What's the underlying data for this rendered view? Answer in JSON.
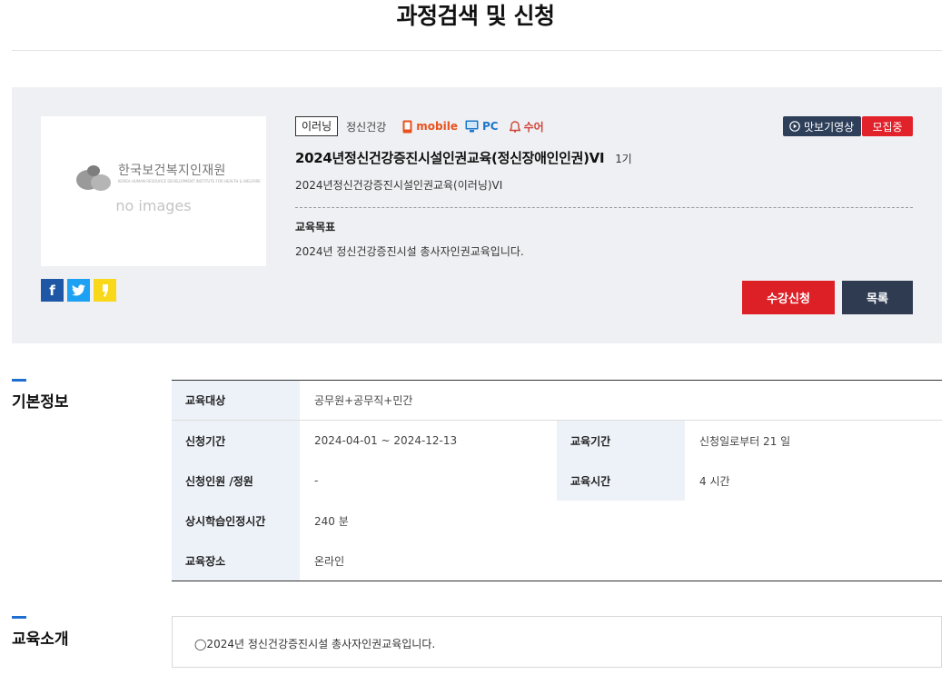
{
  "page": {
    "title": "과정검색 및 신청"
  },
  "thumbnail": {
    "brand": "한국보건복지인재원",
    "brand_sub": "KOREA HUMAN RESOURCE DEVELOPMENT INSTITUTE FOR HEALTH & WELFARE",
    "placeholder": "no images"
  },
  "share": {
    "facebook": "f",
    "twitter": "t",
    "kakaostory": "k"
  },
  "course": {
    "type_tag": "이러닝",
    "category": "정신건강",
    "device_mobile": "mobile",
    "device_pc": "PC",
    "sign_language": "수어",
    "preview_label": "맛보기영상",
    "status_badge": "모집중",
    "title": "2024년정신건강증진시설인권교육(정신장애인인권)VI",
    "round": "1기",
    "subtitle": "2024년정신건강증진시설인권교육(이러닝)VI",
    "goal_label": "교육목표",
    "goal_text": "2024년 정신건강증진시설 총사자인권교육입니다.",
    "apply_label": "수강신청",
    "list_label": "목록"
  },
  "basic_info": {
    "section_title": "기본정보",
    "target_label": "교육대상",
    "target_value": "공무원+공무직+민간",
    "apply_period_label": "신청기간",
    "apply_period_value": "2024-04-01 ~ 2024-12-13",
    "edu_period_label": "교육기간",
    "edu_period_value": "신청일로부터 21 일",
    "capacity_label": "신청인원 /정원",
    "capacity_value": "-",
    "edu_hours_label": "교육시간",
    "edu_hours_value": "4 시간",
    "credit_label": "상시학습인정시간",
    "credit_value": "240 분",
    "place_label": "교육장소",
    "place_value": "온라인"
  },
  "intro": {
    "section_title": "교육소개",
    "text": "◯2024년 정신건강증진시설 총사자인권교육입니다."
  },
  "colors": {
    "accent_red": "#dd1f26",
    "navy": "#2e3b51",
    "panel_bg": "#eff0f3",
    "section_blue": "#1f6fd1"
  }
}
